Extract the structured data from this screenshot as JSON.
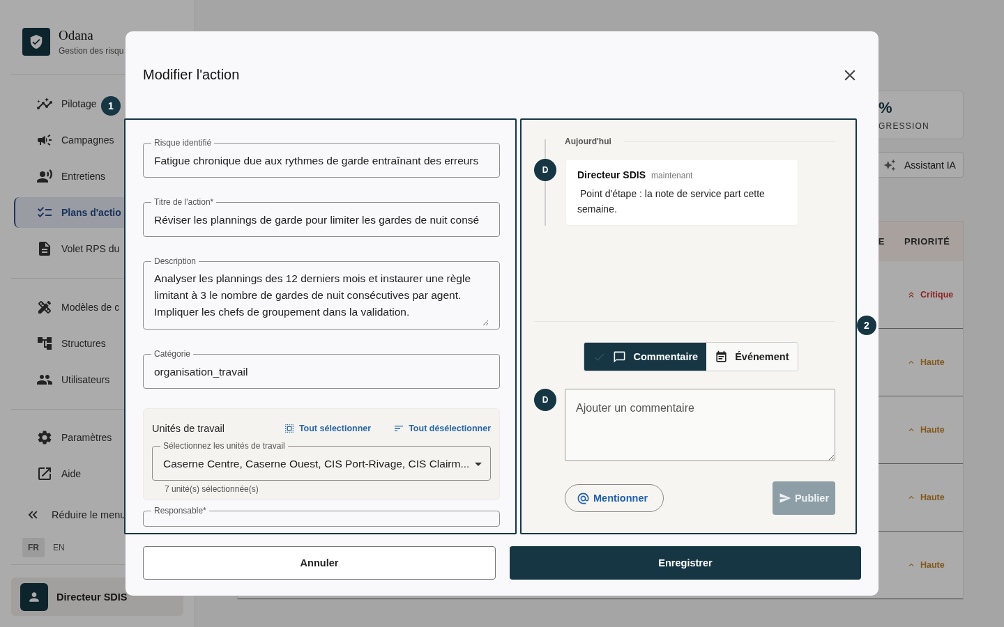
{
  "sidebar": {
    "brand": {
      "name": "Odana",
      "subtitle": "Gestion des risqu"
    },
    "nav_groups": [
      [
        {
          "label": "Pilotage",
          "selected": false
        },
        {
          "label": "Campagnes",
          "selected": false
        },
        {
          "label": "Entretiens",
          "selected": false
        },
        {
          "label": "Plans d'actio",
          "selected": true
        },
        {
          "label": "Volet RPS du",
          "selected": false
        }
      ],
      [
        {
          "label": "Modèles de c",
          "selected": false
        },
        {
          "label": "Structures",
          "selected": false
        },
        {
          "label": "Utilisateurs",
          "selected": false
        }
      ],
      [
        {
          "label": "Paramètres",
          "selected": false
        },
        {
          "label": "Aide",
          "selected": false
        }
      ]
    ],
    "collapse": "Réduire le menu",
    "languages": [
      {
        "label": "FR",
        "selected": true
      },
      {
        "label": "EN",
        "selected": false
      }
    ],
    "user": {
      "name": "Directeur SDIS"
    }
  },
  "main": {
    "stat": {
      "value": "%",
      "label": "GRESSION"
    },
    "assistant_button": "Assistant IA",
    "table": {
      "columns": [
        "E",
        "PRIORITÉ"
      ],
      "rows": [
        {
          "priority": "Critique",
          "kind": "critical",
          "color": "#8c2525"
        },
        {
          "priority": "Haute",
          "kind": "high",
          "color": "#82581c"
        },
        {
          "priority": "Haute",
          "kind": "high",
          "color": "#82581c"
        },
        {
          "priority": "Haute",
          "kind": "high",
          "color": "#82581c"
        },
        {
          "priority": "Haute",
          "kind": "high",
          "color": "#82581c"
        }
      ]
    }
  },
  "step_markers": [
    {
      "label": "1"
    },
    {
      "label": "2"
    }
  ],
  "modal": {
    "title": "Modifier l'action",
    "fields": [
      {
        "kind": "input",
        "label": "Risque identifié",
        "value": "Fatigue chronique due aux rythmes de garde entraînant des erreurs"
      },
      {
        "kind": "input",
        "label": "Titre de l'action*",
        "value": "Réviser les plannings de garde pour limiter les gardes de nuit consé"
      },
      {
        "kind": "textarea",
        "label": "Description",
        "value": "Analyser les plannings des 12 derniers mois et instaurer une règle limitant à 3 le nombre de gardes de nuit consécutives par agent. Impliquer les chefs de groupement dans la validation."
      },
      {
        "kind": "input",
        "label": "Catégorie",
        "value": "organisation_travail"
      }
    ],
    "units": {
      "title": "Unités de travail",
      "select_all": "Tout sélectionner",
      "deselect_all": "Tout désélectionner",
      "select_label": "Sélectionnez les unités de travail",
      "select_value": "Caserne Centre, Caserne Ouest, CIS Port-Rivage, CIS Clairm...",
      "helper": "7 unité(s) sélectionnée(s)"
    },
    "next_field_label": "Responsable*",
    "activity": {
      "date": "Aujourd'hui",
      "entries": [
        {
          "avatar": "D",
          "author": "Directeur SDIS",
          "time": "maintenant",
          "text": " Point d'étape : la note de service part cette semaine."
        }
      ],
      "modes": [
        {
          "label": "Commentaire",
          "selected": true
        },
        {
          "label": "Événement",
          "selected": false
        }
      ],
      "composer": {
        "avatar": "D",
        "placeholder": "Ajouter un commentaire"
      },
      "mention": "Mentionner",
      "publish": {
        "label": "Publier",
        "disabled": true
      }
    },
    "cancel": "Annuler",
    "save": "Enregistrer"
  }
}
